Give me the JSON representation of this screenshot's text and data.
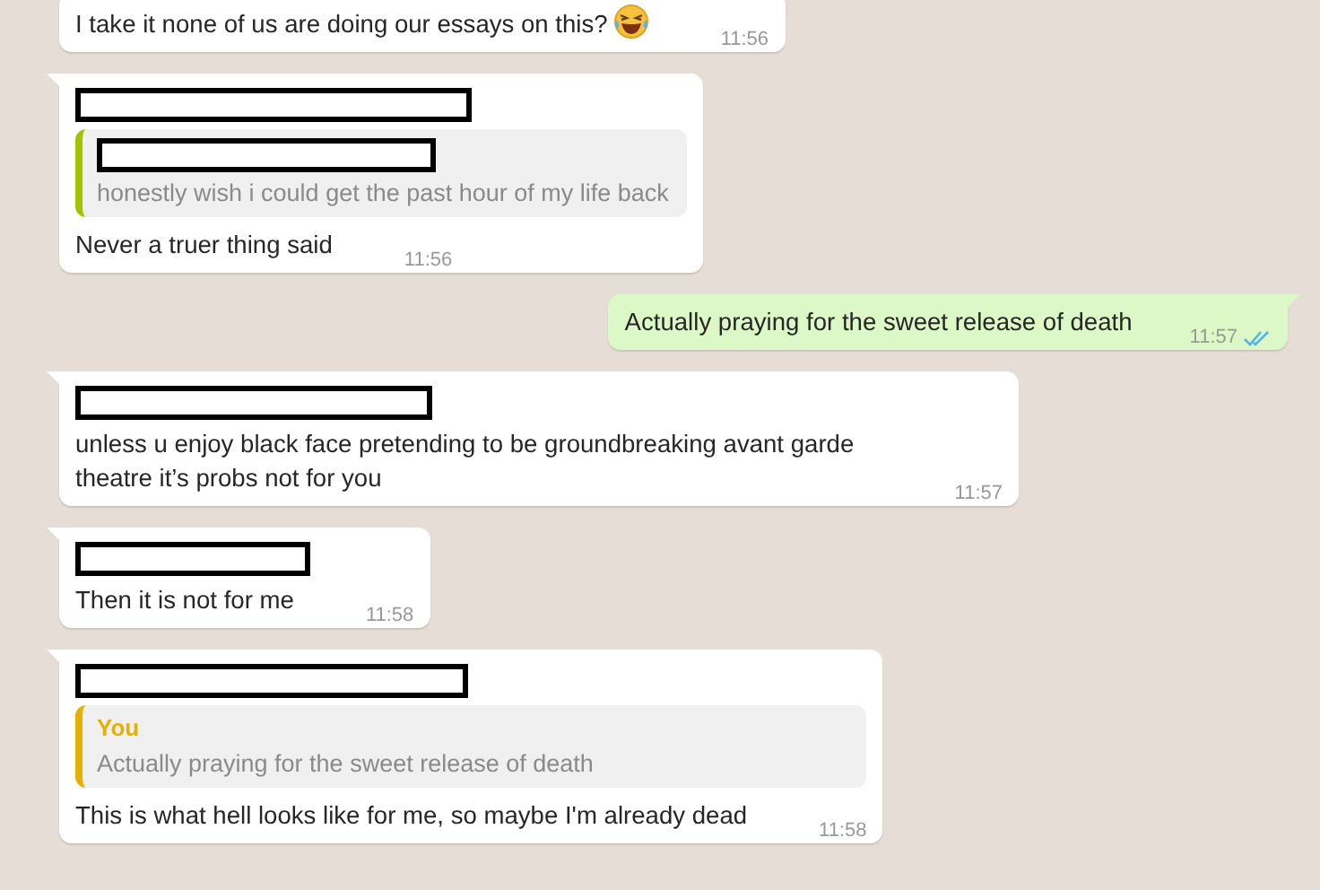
{
  "messages": [
    {
      "kind": "incoming",
      "tail": false,
      "text": "I take it none of us are doing our essays on this?",
      "emoji": true,
      "time": "11:56"
    },
    {
      "kind": "incoming",
      "tail": true,
      "sender_redacted": true,
      "quote": {
        "sender_redacted": true,
        "color": "#a3c300",
        "text": "honestly wish i could get the past hour of my life back"
      },
      "text": "Never a truer thing said",
      "time": "11:56"
    },
    {
      "kind": "outgoing",
      "tail": true,
      "text": "Actually praying for the sweet release of death",
      "time": "11:57",
      "read": true
    },
    {
      "kind": "incoming",
      "tail": true,
      "sender_redacted": true,
      "text": "unless u enjoy black face pretending to be groundbreaking avant garde theatre it’s probs not for you",
      "time": "11:57"
    },
    {
      "kind": "incoming",
      "tail": true,
      "sender_redacted": true,
      "text": "Then it is not for me",
      "time": "11:58"
    },
    {
      "kind": "incoming",
      "tail": true,
      "sender_redacted": true,
      "quote": {
        "author": "You",
        "color": "#e5b000",
        "text": "Actually praying for the sweet release of death"
      },
      "text": "This is what hell looks like for me, so maybe I'm already dead",
      "time": "11:58"
    }
  ]
}
